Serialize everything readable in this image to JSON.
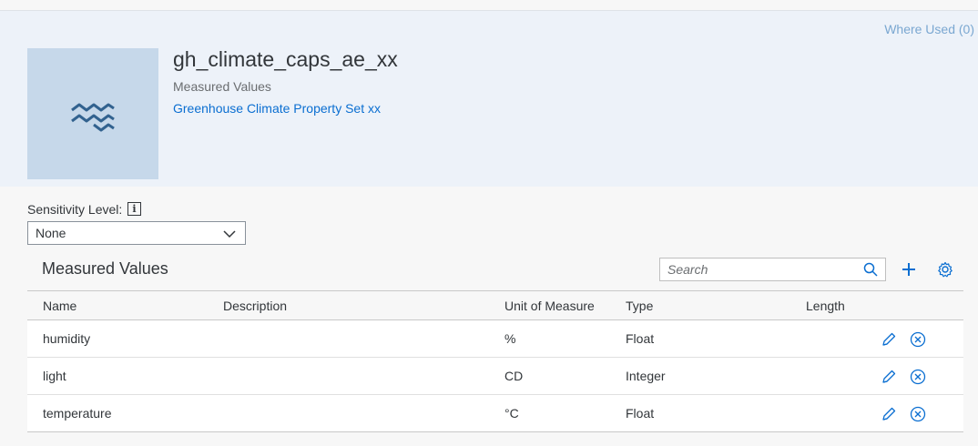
{
  "header": {
    "where_used": "Where Used (0)",
    "title": "gh_climate_caps_ae_xx",
    "subtitle": "Measured Values",
    "link": "Greenhouse Climate Property Set xx",
    "avatar_icon": "wave-icon"
  },
  "sensitivity": {
    "label": "Sensitivity Level:",
    "info_icon": "i",
    "selected": "None"
  },
  "table": {
    "title": "Measured Values",
    "search_placeholder": "Search",
    "columns": [
      "Name",
      "Description",
      "Unit of Measure",
      "Type",
      "Length"
    ],
    "rows": [
      {
        "name": "humidity",
        "description": "",
        "uom": "%",
        "type": "Float",
        "length": ""
      },
      {
        "name": "light",
        "description": "",
        "uom": "CD",
        "type": "Integer",
        "length": ""
      },
      {
        "name": "temperature",
        "description": "",
        "uom": "°C",
        "type": "Float",
        "length": ""
      }
    ]
  },
  "colors": {
    "accent": "#0a6ed1",
    "header_bg": "#edf2f9",
    "avatar_bg": "#c6d8ea",
    "icon": "#0a6ed1"
  }
}
